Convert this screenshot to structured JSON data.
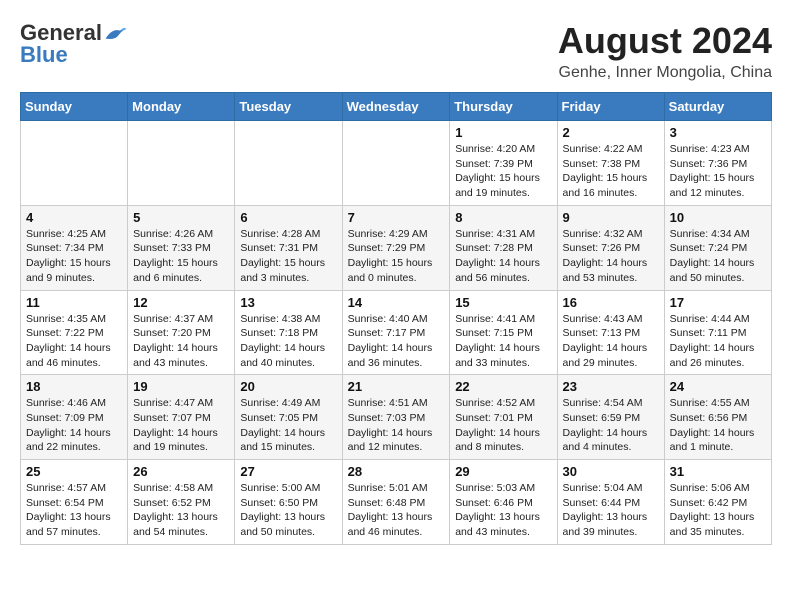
{
  "header": {
    "logo_general": "General",
    "logo_blue": "Blue",
    "title": "August 2024",
    "subtitle": "Genhe, Inner Mongolia, China"
  },
  "weekdays": [
    "Sunday",
    "Monday",
    "Tuesday",
    "Wednesday",
    "Thursday",
    "Friday",
    "Saturday"
  ],
  "weeks": [
    [
      {
        "day": "",
        "info": ""
      },
      {
        "day": "",
        "info": ""
      },
      {
        "day": "",
        "info": ""
      },
      {
        "day": "",
        "info": ""
      },
      {
        "day": "1",
        "info": "Sunrise: 4:20 AM\nSunset: 7:39 PM\nDaylight: 15 hours\nand 19 minutes."
      },
      {
        "day": "2",
        "info": "Sunrise: 4:22 AM\nSunset: 7:38 PM\nDaylight: 15 hours\nand 16 minutes."
      },
      {
        "day": "3",
        "info": "Sunrise: 4:23 AM\nSunset: 7:36 PM\nDaylight: 15 hours\nand 12 minutes."
      }
    ],
    [
      {
        "day": "4",
        "info": "Sunrise: 4:25 AM\nSunset: 7:34 PM\nDaylight: 15 hours\nand 9 minutes."
      },
      {
        "day": "5",
        "info": "Sunrise: 4:26 AM\nSunset: 7:33 PM\nDaylight: 15 hours\nand 6 minutes."
      },
      {
        "day": "6",
        "info": "Sunrise: 4:28 AM\nSunset: 7:31 PM\nDaylight: 15 hours\nand 3 minutes."
      },
      {
        "day": "7",
        "info": "Sunrise: 4:29 AM\nSunset: 7:29 PM\nDaylight: 15 hours\nand 0 minutes."
      },
      {
        "day": "8",
        "info": "Sunrise: 4:31 AM\nSunset: 7:28 PM\nDaylight: 14 hours\nand 56 minutes."
      },
      {
        "day": "9",
        "info": "Sunrise: 4:32 AM\nSunset: 7:26 PM\nDaylight: 14 hours\nand 53 minutes."
      },
      {
        "day": "10",
        "info": "Sunrise: 4:34 AM\nSunset: 7:24 PM\nDaylight: 14 hours\nand 50 minutes."
      }
    ],
    [
      {
        "day": "11",
        "info": "Sunrise: 4:35 AM\nSunset: 7:22 PM\nDaylight: 14 hours\nand 46 minutes."
      },
      {
        "day": "12",
        "info": "Sunrise: 4:37 AM\nSunset: 7:20 PM\nDaylight: 14 hours\nand 43 minutes."
      },
      {
        "day": "13",
        "info": "Sunrise: 4:38 AM\nSunset: 7:18 PM\nDaylight: 14 hours\nand 40 minutes."
      },
      {
        "day": "14",
        "info": "Sunrise: 4:40 AM\nSunset: 7:17 PM\nDaylight: 14 hours\nand 36 minutes."
      },
      {
        "day": "15",
        "info": "Sunrise: 4:41 AM\nSunset: 7:15 PM\nDaylight: 14 hours\nand 33 minutes."
      },
      {
        "day": "16",
        "info": "Sunrise: 4:43 AM\nSunset: 7:13 PM\nDaylight: 14 hours\nand 29 minutes."
      },
      {
        "day": "17",
        "info": "Sunrise: 4:44 AM\nSunset: 7:11 PM\nDaylight: 14 hours\nand 26 minutes."
      }
    ],
    [
      {
        "day": "18",
        "info": "Sunrise: 4:46 AM\nSunset: 7:09 PM\nDaylight: 14 hours\nand 22 minutes."
      },
      {
        "day": "19",
        "info": "Sunrise: 4:47 AM\nSunset: 7:07 PM\nDaylight: 14 hours\nand 19 minutes."
      },
      {
        "day": "20",
        "info": "Sunrise: 4:49 AM\nSunset: 7:05 PM\nDaylight: 14 hours\nand 15 minutes."
      },
      {
        "day": "21",
        "info": "Sunrise: 4:51 AM\nSunset: 7:03 PM\nDaylight: 14 hours\nand 12 minutes."
      },
      {
        "day": "22",
        "info": "Sunrise: 4:52 AM\nSunset: 7:01 PM\nDaylight: 14 hours\nand 8 minutes."
      },
      {
        "day": "23",
        "info": "Sunrise: 4:54 AM\nSunset: 6:59 PM\nDaylight: 14 hours\nand 4 minutes."
      },
      {
        "day": "24",
        "info": "Sunrise: 4:55 AM\nSunset: 6:56 PM\nDaylight: 14 hours\nand 1 minute."
      }
    ],
    [
      {
        "day": "25",
        "info": "Sunrise: 4:57 AM\nSunset: 6:54 PM\nDaylight: 13 hours\nand 57 minutes."
      },
      {
        "day": "26",
        "info": "Sunrise: 4:58 AM\nSunset: 6:52 PM\nDaylight: 13 hours\nand 54 minutes."
      },
      {
        "day": "27",
        "info": "Sunrise: 5:00 AM\nSunset: 6:50 PM\nDaylight: 13 hours\nand 50 minutes."
      },
      {
        "day": "28",
        "info": "Sunrise: 5:01 AM\nSunset: 6:48 PM\nDaylight: 13 hours\nand 46 minutes."
      },
      {
        "day": "29",
        "info": "Sunrise: 5:03 AM\nSunset: 6:46 PM\nDaylight: 13 hours\nand 43 minutes."
      },
      {
        "day": "30",
        "info": "Sunrise: 5:04 AM\nSunset: 6:44 PM\nDaylight: 13 hours\nand 39 minutes."
      },
      {
        "day": "31",
        "info": "Sunrise: 5:06 AM\nSunset: 6:42 PM\nDaylight: 13 hours\nand 35 minutes."
      }
    ]
  ]
}
